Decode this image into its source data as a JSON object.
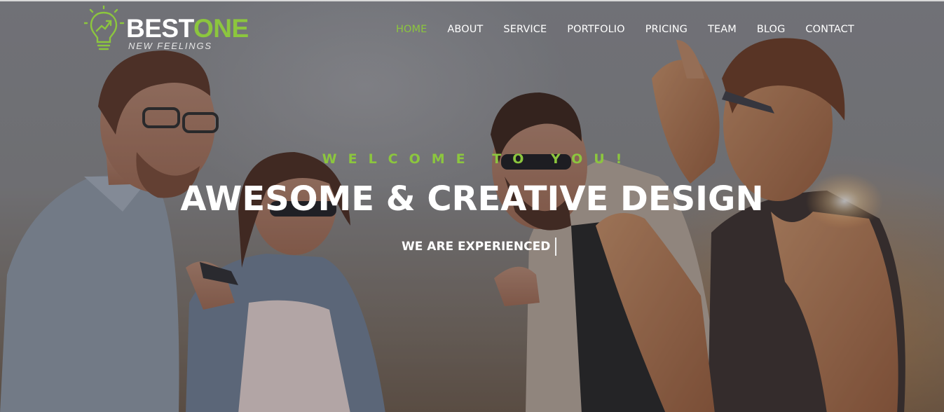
{
  "brand": {
    "word1": "BEST",
    "word2": "ONE",
    "tagline": "NEW FEELINGS",
    "accent_color": "#8cc63e",
    "icon": "lightbulb-growth-icon"
  },
  "nav": {
    "items": [
      {
        "label": "HOME",
        "active": true
      },
      {
        "label": "ABOUT",
        "active": false
      },
      {
        "label": "SERVICE",
        "active": false
      },
      {
        "label": "PORTFOLIO",
        "active": false
      },
      {
        "label": "PRICING",
        "active": false
      },
      {
        "label": "TEAM",
        "active": false
      },
      {
        "label": "BLOG",
        "active": false
      },
      {
        "label": "CONTACT",
        "active": false
      }
    ]
  },
  "hero": {
    "welcome": "WELCOME TO YOU!",
    "headline": "AWESOME & CREATIVE DESIGN",
    "subline": "WE ARE EXPERIENCED",
    "background": "photo-friends-laughing-sunset"
  }
}
